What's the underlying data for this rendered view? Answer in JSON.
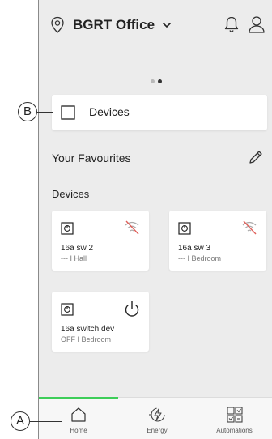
{
  "header": {
    "location_title": "BGRT Office",
    "icons": [
      "location-pin-icon",
      "chevron-down-icon",
      "bell-icon",
      "user-icon"
    ]
  },
  "pager": {
    "pages": 2,
    "active": 2
  },
  "devices_card": {
    "label": "Devices"
  },
  "favourites": {
    "title": "Your Favourites",
    "section_title": "Devices"
  },
  "tiles": [
    {
      "name": "16a sw 2",
      "status": "--- I Hall",
      "state_icon": "wifi-off-icon"
    },
    {
      "name": "16a sw 3",
      "status": "--- I Bedroom",
      "state_icon": "wifi-off-icon"
    },
    {
      "name": "16a switch dev",
      "status": "OFF I Bedroom",
      "state_icon": "power-icon"
    }
  ],
  "tabs": [
    {
      "label": "Home",
      "active": true
    },
    {
      "label": "Energy",
      "active": false
    },
    {
      "label": "Automations",
      "active": false
    }
  ],
  "callouts": {
    "a": "A",
    "b": "B"
  },
  "colors": {
    "accent": "#3dcd58",
    "background": "#ececec",
    "card": "#ffffff",
    "wifi_off": "#e0605a"
  }
}
